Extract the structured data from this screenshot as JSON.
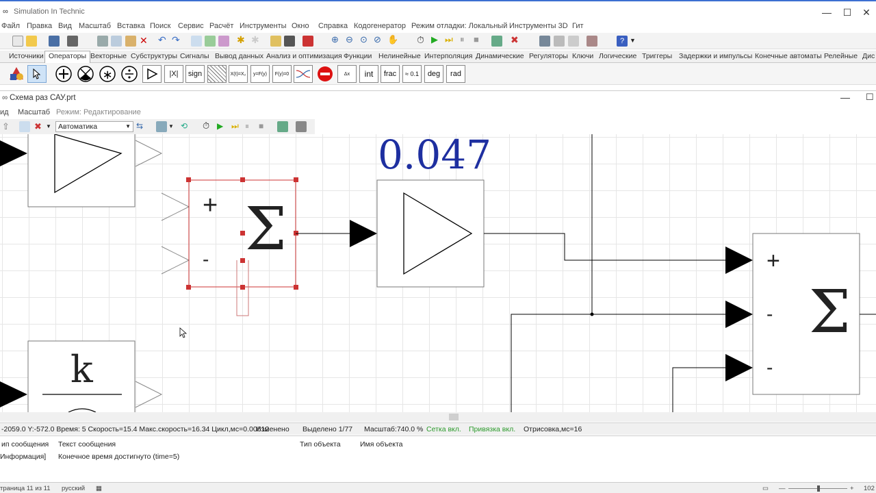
{
  "window": {
    "title": "Simulation In Technic"
  },
  "menu": [
    "Файл",
    "Правка",
    "Вид",
    "Масштаб",
    "Вставка",
    "Поиск",
    "Сервис",
    "Расчёт",
    "Инструменты",
    "Окно",
    "Справка",
    "Кодогенератор",
    "Режим отладки: Локальный",
    "Инструменты 3D",
    "Гит"
  ],
  "tabs": [
    "Источники",
    "Операторы",
    "Векторные",
    "Субструктуры",
    "Сигналы",
    "Вывод данных",
    "Анализ и оптимизация",
    "Функции",
    "Нелинейные",
    "Интерполяция",
    "Динамические",
    "Регуляторы",
    "Ключи",
    "Логические",
    "Триггеры",
    "Задержки и импульсы",
    "Конечные автоматы",
    "Релейные",
    "Дис"
  ],
  "active_tab": "Операторы",
  "palette": [
    "+",
    "⊗",
    "∗",
    "÷",
    "▷",
    "|X|",
    "sign",
    "▨",
    "X(t)=X₂",
    "y=F(y)",
    "F(y)=0",
    "~",
    "⊖",
    "Δx",
    "int",
    "frac",
    "≈ 0.1",
    "deg",
    "rad"
  ],
  "document": {
    "title": "Схема раз САУ.prt",
    "menu": [
      "ид",
      "Масштаб"
    ],
    "mode": "Режим: Редактирование",
    "combo_value": "Автоматика"
  },
  "diagram": {
    "display_value": "0.047",
    "sum1_signs": [
      "+",
      "-"
    ],
    "sum2_signs": [
      "+",
      "-",
      "-"
    ],
    "sigma": "Σ",
    "gain_label": "k"
  },
  "status": {
    "coords": "-2059.0  Y:-572.0 Время: 5 Скорость=15.4 Макс.скорость=16.34 Цикл,мс=0.00612",
    "changed": "Изменено",
    "selected": "Выделено 1/77",
    "zoom": "Масштаб:740.0 %",
    "grid": "Сетка вкл.",
    "snap": "Привязка вкл.",
    "render": "Отрисовка,мс=16"
  },
  "messages": {
    "headers": {
      "type": "ип сообщения",
      "text": "Текст сообщения",
      "object_type": "Тип объекта",
      "object_name": "Имя объекта"
    },
    "rows": [
      {
        "type": "Информация]",
        "text": "Конечное время достигнуто (time=5)"
      }
    ]
  },
  "bottom": {
    "page": "траница 11 из 11",
    "lang": "русский",
    "zoom": "102"
  },
  "colors": {
    "selection": "#cc3333",
    "display": "#1e2fa0",
    "grid_on": "#2b9a2b",
    "accent": "#3c6fd1"
  }
}
